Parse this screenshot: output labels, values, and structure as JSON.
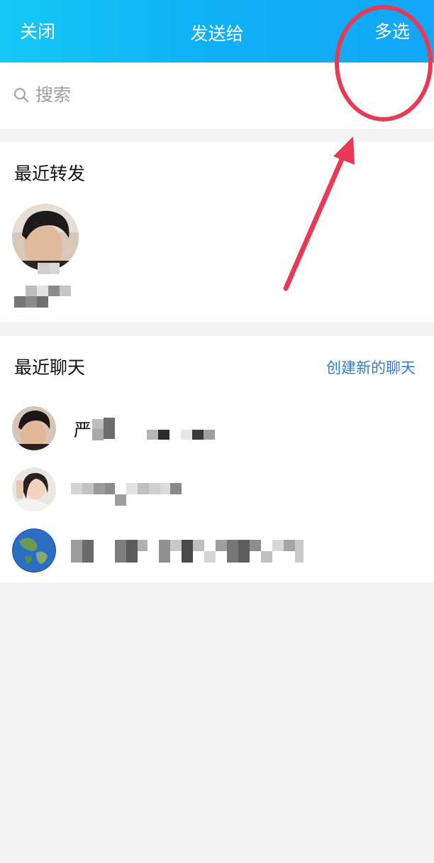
{
  "header": {
    "close_label": "关闭",
    "title": "发送给",
    "multi_select_label": "多选"
  },
  "search": {
    "placeholder": "搜索",
    "icon": "search-icon"
  },
  "recent_forward": {
    "title": "最近转发",
    "items": [
      {
        "avatar": "avatar-photo",
        "name": ""
      }
    ]
  },
  "recent_chats": {
    "title": "最近聊天",
    "create_link": "创建新的聊天",
    "items": [
      {
        "avatar": "avatar-photo",
        "name": "严"
      },
      {
        "avatar": "avatar-photo",
        "name": ""
      },
      {
        "avatar": "globe-avatar",
        "name": ""
      }
    ]
  },
  "colors": {
    "header_start": "#13c8f7",
    "header_end": "#12a6f7",
    "link": "#2f7fd1",
    "annotation": "#e83a55",
    "background": "#f3f3f3"
  }
}
